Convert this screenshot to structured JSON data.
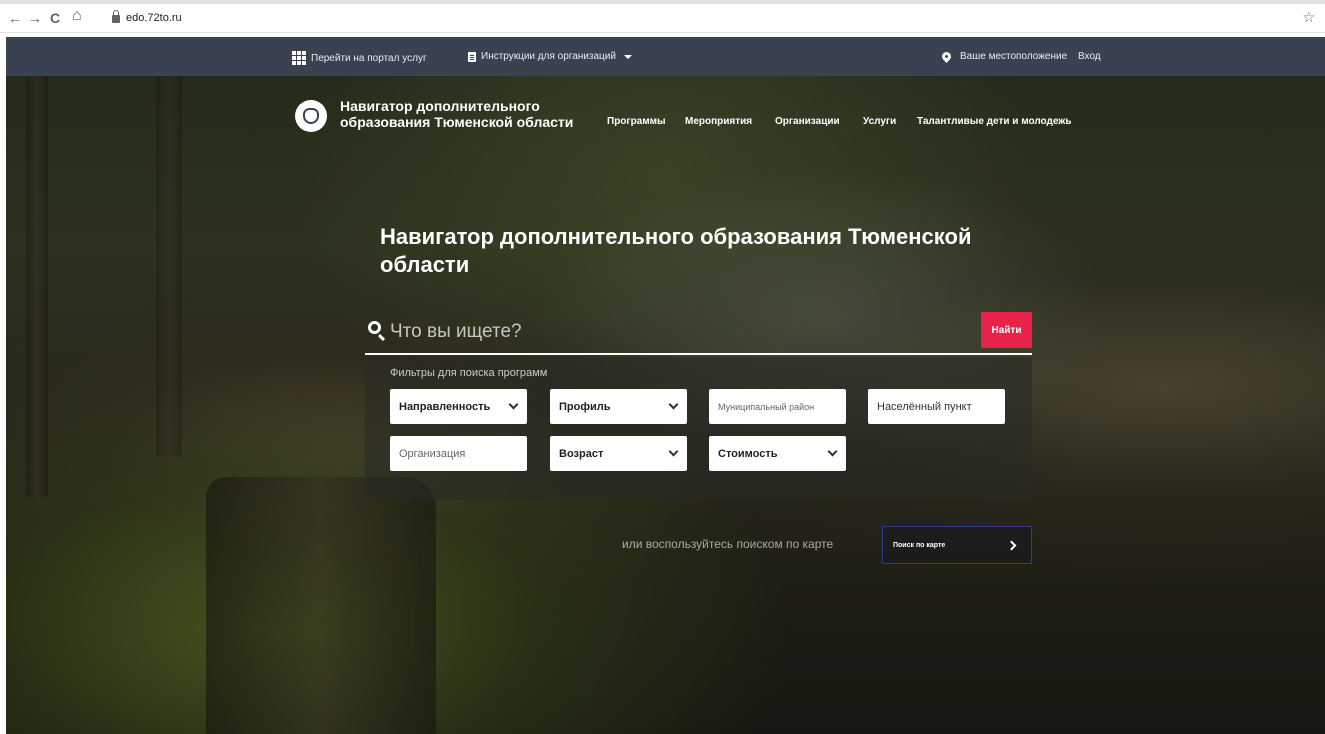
{
  "browser": {
    "url": "edo.72to.ru",
    "back": "←",
    "forward": "→",
    "reload": "C",
    "home": "⌂",
    "bookmark": "☆"
  },
  "topbar": {
    "portal_link": "Перейти на портал услуг",
    "instructions": "Инструкции для организаций",
    "location": "Ваше местоположение",
    "login": "Вход"
  },
  "header": {
    "brand_line1": "Навигатор дополнительного",
    "brand_line2": "образования Тюменской области",
    "nav": [
      "Программы",
      "Мероприятия",
      "Организации",
      "Услуги",
      "Талантливые дети и молодежь"
    ]
  },
  "hero": {
    "title": "Навигатор дополнительного образования Тюменской области"
  },
  "search": {
    "placeholder": "Что вы ищете?",
    "button": "Найти"
  },
  "filters": {
    "label": "Фильтры для поиска программ",
    "direction": "Направленность",
    "profile": "Профиль",
    "district": "Муниципальный район",
    "settlement": "Населённый пункт",
    "organization": "Организация",
    "age": "Возраст",
    "cost": "Стоимость"
  },
  "map": {
    "text": "или воспользуйтесь поиском по карте",
    "button": "Поиск по карте"
  }
}
